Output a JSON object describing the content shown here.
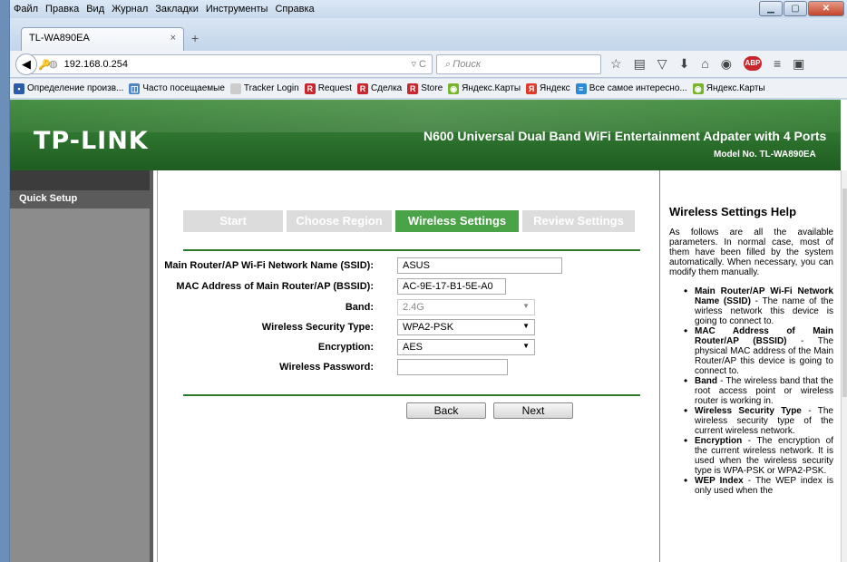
{
  "menubar": {
    "items": [
      "Файл",
      "Правка",
      "Вид",
      "Журнал",
      "Закладки",
      "Инструменты",
      "Справка"
    ]
  },
  "tab": {
    "title": "TL-WA890EA",
    "close": "×",
    "newtab": "+"
  },
  "nav": {
    "url": "192.168.0.254",
    "search_placeholder": "Поиск"
  },
  "bookmarks": [
    {
      "label": "Определение произв...",
      "icon_color": "#2a5caa",
      "glyph": "▪"
    },
    {
      "label": "Часто посещаемые",
      "icon_color": "#4c84c5",
      "glyph": "◫"
    },
    {
      "label": "Tracker Login",
      "icon_color": "#cccccc",
      "glyph": " "
    },
    {
      "label": "Request",
      "icon_color": "#c8272e",
      "glyph": "R"
    },
    {
      "label": "Сделка",
      "icon_color": "#c8272e",
      "glyph": "R"
    },
    {
      "label": "Store",
      "icon_color": "#c8272e",
      "glyph": "R"
    },
    {
      "label": "Яндекс.Карты",
      "icon_color": "#79b52c",
      "glyph": "◉"
    },
    {
      "label": "Яндекс",
      "icon_color": "#e23a2a",
      "glyph": "Я"
    },
    {
      "label": "Все самое интересно...",
      "icon_color": "#2a8ad6",
      "glyph": "≡"
    },
    {
      "label": "Яндекс.Карты",
      "icon_color": "#79b52c",
      "glyph": "◉"
    }
  ],
  "header": {
    "logo": "TP-LINK",
    "title": "N600 Universal Dual Band WiFi Entertainment Adpater with 4 Ports",
    "model": "Model No. TL-WA890EA"
  },
  "sidebar": {
    "item": "Quick Setup"
  },
  "steps": [
    {
      "label": "Start",
      "active": false
    },
    {
      "label": "Choose Region",
      "active": false
    },
    {
      "label": "Wireless Settings",
      "active": true
    },
    {
      "label": "Review Settings",
      "active": false
    }
  ],
  "form": {
    "ssid_label": "Main Router/AP Wi-Fi Network Name (SSID):",
    "ssid_value": "ASUS",
    "bssid_label": "MAC Address of Main Router/AP (BSSID):",
    "bssid_value": "AC-9E-17-B1-5E-A0",
    "band_label": "Band:",
    "band_value": "2.4G",
    "security_label": "Wireless Security Type:",
    "security_value": "WPA2-PSK",
    "encryption_label": "Encryption:",
    "encryption_value": "AES",
    "password_label": "Wireless Password:",
    "password_value": ""
  },
  "buttons": {
    "back": "Back",
    "next": "Next"
  },
  "help": {
    "title": "Wireless Settings Help",
    "intro": "As follows are all the available parameters. In normal case, most of them have been filled by the system automatically. When necessary, you can modify them manually.",
    "items": [
      {
        "term": "Main Router/AP Wi-Fi Network Name (SSID)",
        "desc": " - The name of the wirless network this device is going to connect to."
      },
      {
        "term": "MAC Address of Main Router/AP (BSSID)",
        "desc": " - The physical MAC address of the Main Router/AP this device is going to connect to."
      },
      {
        "term": "Band",
        "desc": " - The wireless band that the root access point or wireless router is working in."
      },
      {
        "term": "Wireless Security Type",
        "desc": " - The wireless security type of the current wireless network."
      },
      {
        "term": "Encryption",
        "desc": " - The encryption of the current wireless network. It is used when the wireless security type is WPA-PSK or WPA2-PSK."
      },
      {
        "term": "WEP Index",
        "desc": " - The WEP index is only used when the"
      }
    ]
  },
  "colors": {
    "accent_green": "#4aa347",
    "header_green": "#2b6f2b"
  }
}
